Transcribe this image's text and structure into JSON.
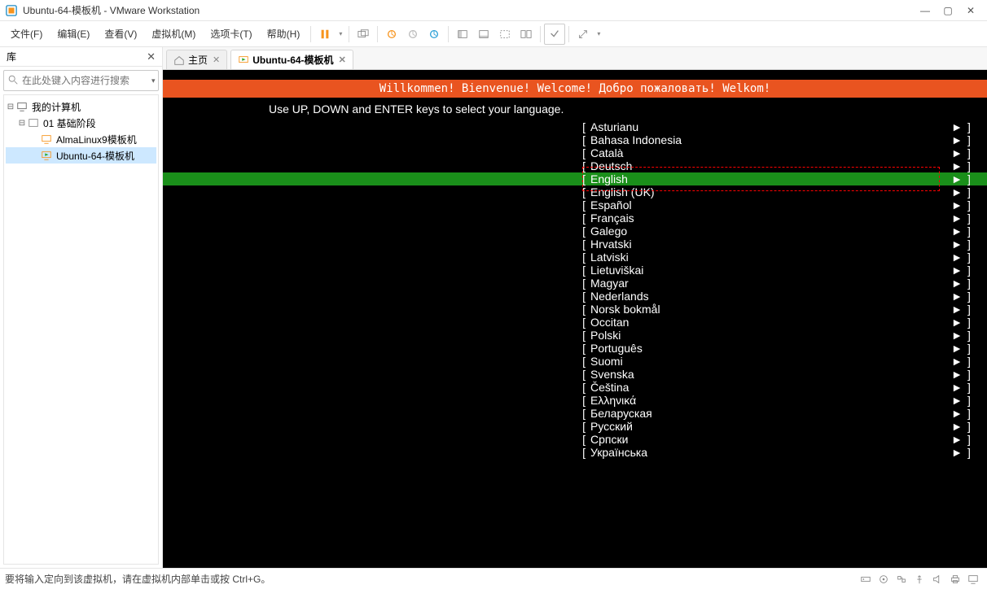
{
  "title": "Ubuntu-64-模板机 - VMware Workstation",
  "menus": [
    "文件(F)",
    "编辑(E)",
    "查看(V)",
    "虚拟机(M)",
    "选项卡(T)",
    "帮助(H)"
  ],
  "sidebar": {
    "title": "库",
    "search_placeholder": "在此处键入内容进行搜索",
    "tree": {
      "root": "我的计算机",
      "folder": "01 基础阶段",
      "vm1": "AlmaLinux9模板机",
      "vm2": "Ubuntu-64-模板机"
    }
  },
  "tabs": {
    "home": "主页",
    "vm": "Ubuntu-64-模板机"
  },
  "installer": {
    "banner": "Willkommen! Bienvenue! Welcome! Добро пожаловать! Welkom!",
    "instruction": "Use UP, DOWN and ENTER keys to select your language.",
    "selected_index": 4,
    "languages": [
      "Asturianu",
      "Bahasa Indonesia",
      "Català",
      "Deutsch",
      "English",
      "English (UK)",
      "Español",
      "Français",
      "Galego",
      "Hrvatski",
      "Latviski",
      "Lietuviškai",
      "Magyar",
      "Nederlands",
      "Norsk bokmål",
      "Occitan",
      "Polski",
      "Português",
      "Suomi",
      "Svenska",
      "Čeština",
      "Ελληνικά",
      "Беларуская",
      "Русский",
      "Српски",
      "Українська"
    ]
  },
  "status": "要将输入定向到该虚拟机，请在虚拟机内部单击或按 Ctrl+G。"
}
